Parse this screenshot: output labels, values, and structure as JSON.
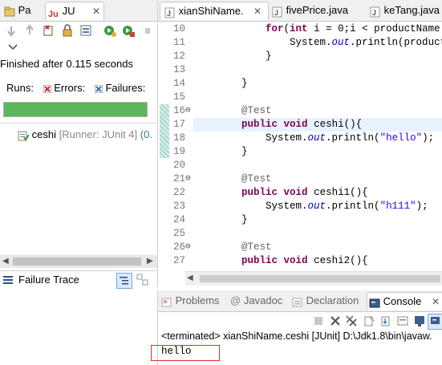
{
  "junit": {
    "tabs": [
      {
        "label": "Pa",
        "icon": "package-explorer-icon"
      },
      {
        "label": "JU",
        "icon": "junit-icon"
      }
    ],
    "status": "Finished after 0.115 seconds",
    "runs_label": "Runs:",
    "errors_label": "Errors:",
    "failures_label": "Failures:",
    "progress": 1.0,
    "progress_color": "#5cb85c",
    "tree_item": {
      "name": "ceshi",
      "runner": "[Runner: JUnit 4]",
      "time": "(0."
    },
    "failure_trace_label": "Failure Trace"
  },
  "editor": {
    "tabs": [
      {
        "label": "xianShiName.",
        "icon": "java-file-icon",
        "active": true
      },
      {
        "label": "fivePrice.java",
        "icon": "java-file-icon",
        "active": false
      },
      {
        "label": "keTang.java",
        "icon": "java-file-icon",
        "active": false
      }
    ],
    "lines": [
      {
        "num": "10",
        "fold": "",
        "text": "        for(int i = 0;i < productName.l"
      },
      {
        "num": "11",
        "fold": "",
        "text": "            System.out.println(productN"
      },
      {
        "num": "12",
        "fold": "",
        "text": "        }"
      },
      {
        "num": "13",
        "fold": "",
        "text": ""
      },
      {
        "num": "14",
        "fold": "",
        "text": "    }"
      },
      {
        "num": "15",
        "fold": "",
        "text": ""
      },
      {
        "num": "16",
        "fold": "⊖",
        "text": "    @Test"
      },
      {
        "num": "17",
        "fold": "",
        "text": "    public void ceshi(){"
      },
      {
        "num": "18",
        "fold": "",
        "text": "        System.out.println(\"hello\");"
      },
      {
        "num": "19",
        "fold": "",
        "text": "    }"
      },
      {
        "num": "20",
        "fold": "",
        "text": ""
      },
      {
        "num": "21",
        "fold": "⊖",
        "text": "    @Test"
      },
      {
        "num": "22",
        "fold": "",
        "text": "    public void ceshi1(){"
      },
      {
        "num": "23",
        "fold": "",
        "text": "        System.out.println(\"h111\");"
      },
      {
        "num": "24",
        "fold": "",
        "text": "    }"
      },
      {
        "num": "25",
        "fold": "",
        "text": ""
      },
      {
        "num": "26",
        "fold": "⊖",
        "text": "    @Test"
      },
      {
        "num": "27",
        "fold": "",
        "text": "    public void ceshi2(){"
      }
    ]
  },
  "console": {
    "tabs": [
      {
        "label": "Problems",
        "icon": "problems-icon"
      },
      {
        "label": "Javadoc",
        "icon": "at-icon"
      },
      {
        "label": "Declaration",
        "icon": "declaration-icon"
      },
      {
        "label": "Console",
        "icon": "console-icon",
        "active": true
      }
    ],
    "terminated_line": "<terminated> xianShiName.ceshi [JUnit] D:\\Jdk1.8\\bin\\javaw.",
    "output": "hello",
    "highlight_color": "#e03030"
  }
}
